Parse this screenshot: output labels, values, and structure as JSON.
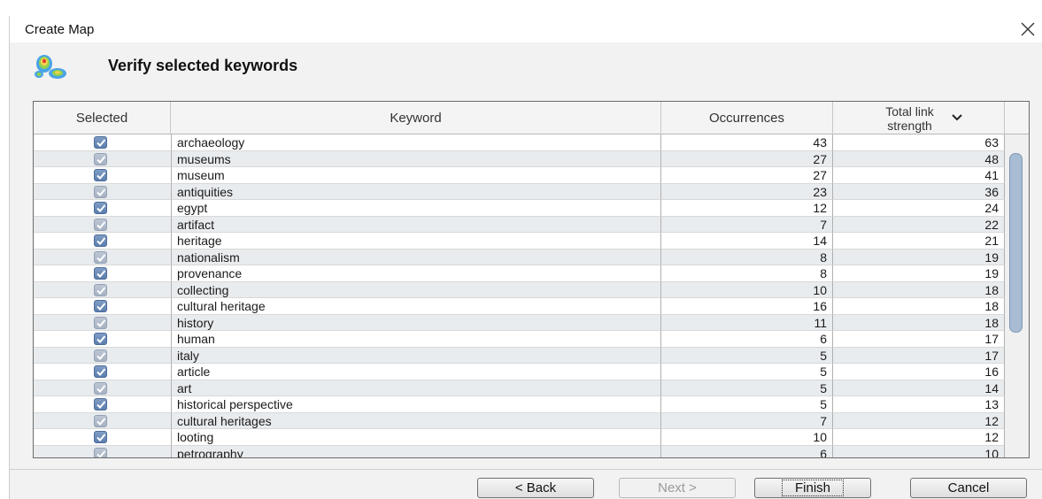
{
  "window": {
    "title": "Create Map",
    "close_icon": "close-icon"
  },
  "header": {
    "title": "Verify selected keywords",
    "icon": "vosviewer-map-icon"
  },
  "table": {
    "columns": {
      "selected": "Selected",
      "keyword": "Keyword",
      "occurrences": "Occurrences",
      "total_link_strength": "Total link strength"
    },
    "sort_icon": "chevron-down-icon",
    "rows": [
      {
        "selected": true,
        "keyword": "archaeology",
        "occurrences": "43",
        "tls": "63"
      },
      {
        "selected": true,
        "keyword": "museums",
        "occurrences": "27",
        "tls": "48"
      },
      {
        "selected": true,
        "keyword": "museum",
        "occurrences": "27",
        "tls": "41"
      },
      {
        "selected": true,
        "keyword": "antiquities",
        "occurrences": "23",
        "tls": "36"
      },
      {
        "selected": true,
        "keyword": "egypt",
        "occurrences": "12",
        "tls": "24"
      },
      {
        "selected": true,
        "keyword": "artifact",
        "occurrences": "7",
        "tls": "22"
      },
      {
        "selected": true,
        "keyword": "heritage",
        "occurrences": "14",
        "tls": "21"
      },
      {
        "selected": true,
        "keyword": "nationalism",
        "occurrences": "8",
        "tls": "19"
      },
      {
        "selected": true,
        "keyword": "provenance",
        "occurrences": "8",
        "tls": "19"
      },
      {
        "selected": true,
        "keyword": "collecting",
        "occurrences": "10",
        "tls": "18"
      },
      {
        "selected": true,
        "keyword": "cultural heritage",
        "occurrences": "16",
        "tls": "18"
      },
      {
        "selected": true,
        "keyword": "history",
        "occurrences": "11",
        "tls": "18"
      },
      {
        "selected": true,
        "keyword": "human",
        "occurrences": "6",
        "tls": "17"
      },
      {
        "selected": true,
        "keyword": "italy",
        "occurrences": "5",
        "tls": "17"
      },
      {
        "selected": true,
        "keyword": "article",
        "occurrences": "5",
        "tls": "16"
      },
      {
        "selected": true,
        "keyword": "art",
        "occurrences": "5",
        "tls": "14"
      },
      {
        "selected": true,
        "keyword": "historical perspective",
        "occurrences": "5",
        "tls": "13"
      },
      {
        "selected": true,
        "keyword": "cultural heritages",
        "occurrences": "7",
        "tls": "12"
      },
      {
        "selected": true,
        "keyword": "looting",
        "occurrences": "10",
        "tls": "12"
      },
      {
        "selected": true,
        "keyword": "petrography",
        "occurrences": "6",
        "tls": "10"
      }
    ]
  },
  "buttons": {
    "back": "< Back",
    "next": "Next >",
    "finish": "Finish",
    "cancel": "Cancel"
  }
}
